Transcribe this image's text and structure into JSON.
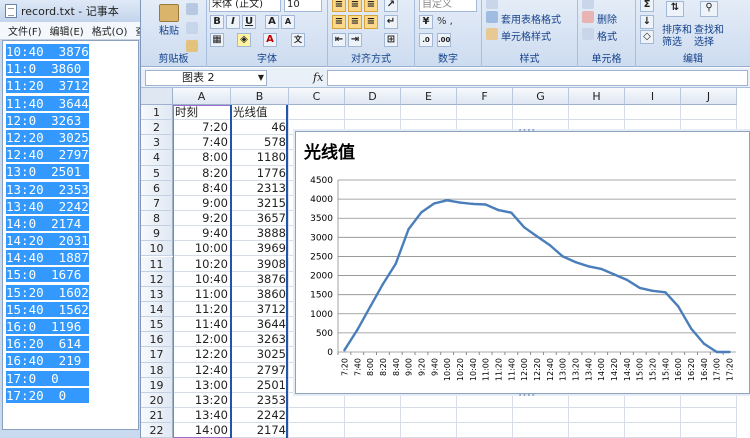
{
  "notepad": {
    "title": "record.txt - 记事本",
    "menu": [
      "文件(F)",
      "编辑(E)",
      "格式(O)",
      "查"
    ],
    "lines": [
      "10:40\t3876",
      "11:0\t3860",
      "11:20\t3712",
      "11:40\t3644",
      "12:0\t3263",
      "12:20\t3025",
      "12:40\t2797",
      "13:0\t2501",
      "13:20\t2353",
      "13:40\t2242",
      "14:0\t2174",
      "14:20\t2031",
      "14:40\t1887",
      "15:0\t1676",
      "15:20\t1602",
      "15:40\t1562",
      "16:0\t1196",
      "16:20\t614",
      "16:40\t219",
      "17:0\t0",
      "17:20\t0"
    ]
  },
  "ribbon": {
    "paste_label": "粘贴",
    "clipboard_label": "剪贴板",
    "font_name": "宋体 (正文)",
    "font_size": "10",
    "font_label": "字体",
    "align_label": "对齐方式",
    "number_format": "自定义",
    "percent": "% ,",
    "number_label": "数字",
    "table_format": "套用表格格式",
    "cell_style": "单元格样式",
    "style_label": "样式",
    "delete_label": "删除",
    "format_label": "格式",
    "cells_label": "单元格",
    "sort_label": "排序和",
    "filter_label": "筛选",
    "find_label": "查找和",
    "select_label": "选择",
    "edit_label": "编辑"
  },
  "formula_bar": {
    "name_box": "图表 2",
    "fx": "fx",
    "formula": ""
  },
  "sheet": {
    "columns": [
      "A",
      "B",
      "C",
      "D",
      "E",
      "F",
      "G",
      "H",
      "I",
      "J"
    ],
    "header_row": [
      "时刻",
      "光线值"
    ],
    "rows": [
      [
        "7:20",
        "46"
      ],
      [
        "7:40",
        "578"
      ],
      [
        "8:00",
        "1180"
      ],
      [
        "8:20",
        "1776"
      ],
      [
        "8:40",
        "2313"
      ],
      [
        "9:00",
        "3215"
      ],
      [
        "9:20",
        "3657"
      ],
      [
        "9:40",
        "3888"
      ],
      [
        "10:00",
        "3969"
      ],
      [
        "10:20",
        "3908"
      ],
      [
        "10:40",
        "3876"
      ],
      [
        "11:00",
        "3860"
      ],
      [
        "11:20",
        "3712"
      ],
      [
        "11:40",
        "3644"
      ],
      [
        "12:00",
        "3263"
      ],
      [
        "12:20",
        "3025"
      ],
      [
        "12:40",
        "2797"
      ],
      [
        "13:00",
        "2501"
      ],
      [
        "13:20",
        "2353"
      ],
      [
        "13:40",
        "2242"
      ],
      [
        "14:00",
        "2174"
      ],
      [
        "14:20",
        "2031"
      ]
    ]
  },
  "chart_data": {
    "type": "line",
    "title": "光线值",
    "x": [
      "7:20",
      "7:40",
      "8:00",
      "8:20",
      "8:40",
      "9:00",
      "9:20",
      "9:40",
      "10:00",
      "10:20",
      "10:40",
      "11:00",
      "11:20",
      "11:40",
      "12:00",
      "12:20",
      "12:40",
      "13:00",
      "13:20",
      "13:40",
      "14:00",
      "14:20",
      "14:40",
      "15:00",
      "15:20",
      "15:40",
      "16:00",
      "16:20",
      "16:40",
      "17:00",
      "17:20"
    ],
    "series": [
      {
        "values": [
          46,
          578,
          1180,
          1776,
          2313,
          3215,
          3657,
          3888,
          3969,
          3908,
          3876,
          3860,
          3712,
          3644,
          3263,
          3025,
          2797,
          2501,
          2353,
          2242,
          2174,
          2031,
          1887,
          1676,
          1602,
          1562,
          1196,
          614,
          219,
          0,
          0
        ]
      }
    ],
    "ylim": [
      0,
      4500
    ],
    "yticks": [
      0,
      500,
      1000,
      1500,
      2000,
      2500,
      3000,
      3500,
      4000,
      4500
    ],
    "grid": true,
    "legend": "none",
    "line_color": "#4a7ebb"
  }
}
